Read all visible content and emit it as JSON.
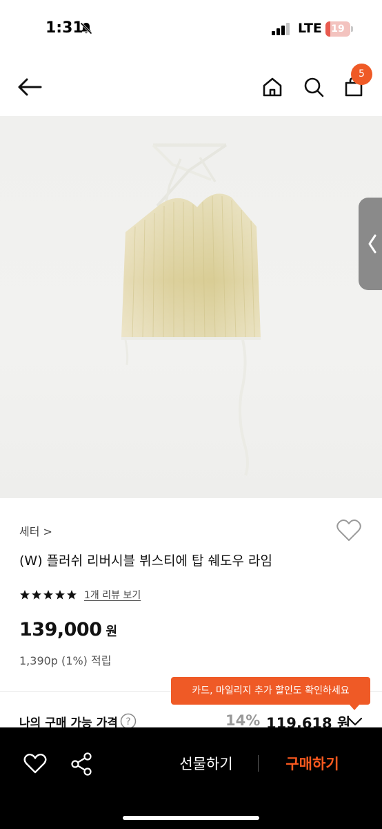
{
  "status_bar": {
    "time": "1:31",
    "network": "LTE",
    "battery": "19",
    "battery_level": 0.19,
    "icons": [
      "bell-slash-icon",
      "signal-icon"
    ]
  },
  "nav": {
    "cart_count": "5",
    "icons": [
      "arrow-left-icon",
      "home-icon",
      "search-icon",
      "cart-icon"
    ]
  },
  "product": {
    "category": "세터 >",
    "title": "(W) 플러쉬 리버시블 뷔스티에 탑 쉐도우 라임",
    "rating": 5,
    "rating_max": 5,
    "review_link": "1개 리뷰 보기",
    "price": "139,000",
    "price_unit": "원",
    "points": "1,390p (1%) 적립"
  },
  "tooltip": {
    "text": "카드, 마일리지 추가 할인도 확인하세요"
  },
  "my_price": {
    "label": "나의 구매 가능 가격",
    "discount": "14%",
    "price": "119,618 원"
  },
  "bottom_bar": {
    "gift_label": "선물하기",
    "buy_label": "구매하기"
  },
  "colors": {
    "accent": "#ef5a26",
    "buy_text": "#ff5a1f",
    "bottom_bar": "#000000"
  }
}
